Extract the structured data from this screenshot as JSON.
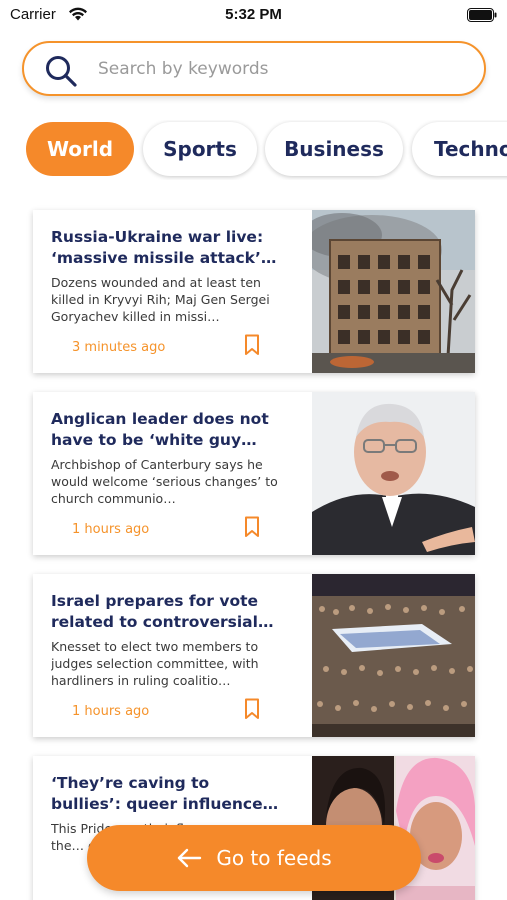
{
  "status_bar": {
    "carrier": "Carrier",
    "time": "5:32 PM",
    "icons": [
      "wifi-icon",
      "battery-icon"
    ]
  },
  "search": {
    "placeholder": "Search by keywords",
    "value": "",
    "icon": "search-icon"
  },
  "categories": [
    {
      "label": "World",
      "selected": true
    },
    {
      "label": "Sports",
      "selected": false
    },
    {
      "label": "Business",
      "selected": false
    },
    {
      "label": "Techno",
      "selected": false
    }
  ],
  "articles": [
    {
      "title": "Russia-Ukraine war live: ‘massive missile attack’ o…",
      "description": "Dozens wounded and at least ten killed in Kryvyi Rih; Maj Gen Sergei Goryachev killed in missi…",
      "time": "3 minutes ago",
      "image": "damaged-building-photo"
    },
    {
      "title": "Anglican leader does not have to be ‘white guy fro…",
      "description": "Archbishop of Canterbury says he would welcome ‘serious changes’ to church communio…",
      "time": "1 hours ago",
      "image": "archbishop-portrait-photo"
    },
    {
      "title": "Israel prepares for vote related to controversial j…",
      "description": "Knesset to elect two members to judges selection committee, with hardliners in ruling coalitio…",
      "time": "1 hours ago",
      "image": "protest-crowd-photo"
    },
    {
      "title": "‘They’re caving to bullies’: queer influencers in the…",
      "description": "This Pride month, influencers say the… comp…",
      "time": "",
      "image": "influencers-photo"
    }
  ],
  "feeds_button": {
    "label": "Go to feeds",
    "icon": "arrow-left-icon"
  },
  "colors": {
    "accent": "#f5892a",
    "title": "#1f2a5c",
    "text": "#3a3a3a"
  }
}
